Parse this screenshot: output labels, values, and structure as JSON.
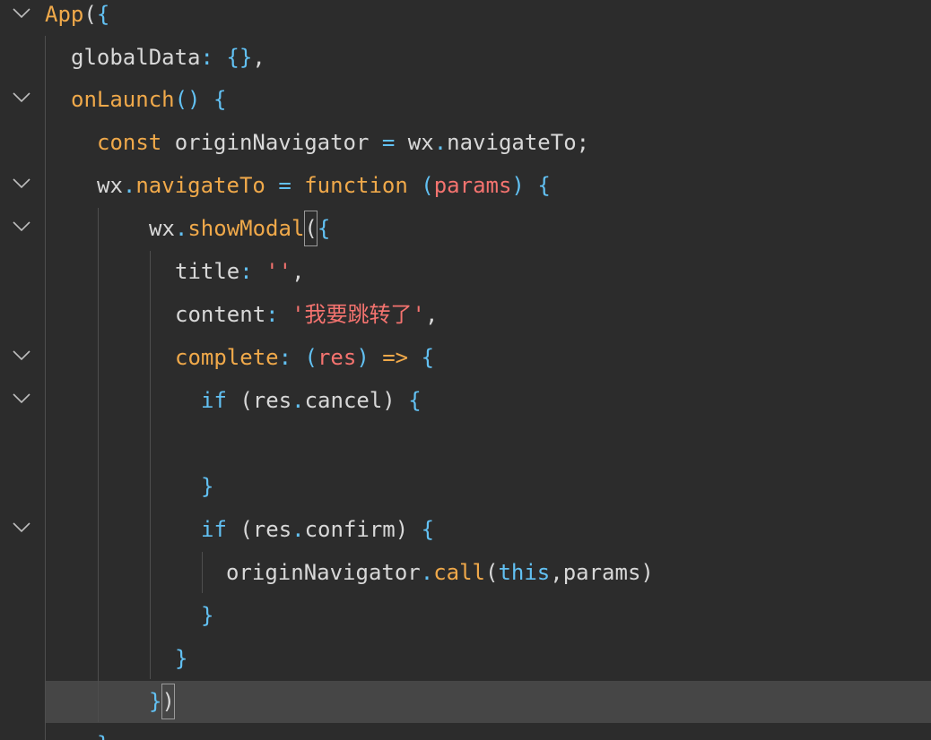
{
  "editor": {
    "lines": [
      {
        "id": "l1",
        "tokens": [
          [
            "App",
            "orange"
          ],
          [
            "(",
            "plain"
          ],
          [
            "{",
            "blue"
          ]
        ]
      },
      {
        "id": "l2",
        "tokens": [
          [
            "globalData",
            "plain"
          ],
          [
            ": ",
            "blue"
          ],
          [
            "{}",
            "blue"
          ],
          [
            ",",
            "plain"
          ]
        ]
      },
      {
        "id": "l3",
        "tokens": [
          [
            "onLaunch",
            "orange"
          ],
          [
            "()",
            "blue"
          ],
          [
            " ",
            "plain"
          ],
          [
            "{",
            "blue"
          ]
        ]
      },
      {
        "id": "l4",
        "tokens": [
          [
            "const",
            "orange"
          ],
          [
            " originNavigator ",
            "plain"
          ],
          [
            "=",
            "blue"
          ],
          [
            " wx",
            "plain"
          ],
          [
            ".",
            "blue"
          ],
          [
            "navigateTo",
            "plain"
          ],
          [
            ";",
            "plain"
          ]
        ]
      },
      {
        "id": "l5",
        "tokens": [
          [
            "wx",
            "plain"
          ],
          [
            ".",
            "blue"
          ],
          [
            "navigateTo",
            "orange"
          ],
          [
            " ",
            "plain"
          ],
          [
            "=",
            "blue"
          ],
          [
            " ",
            "plain"
          ],
          [
            "function",
            "orange"
          ],
          [
            " ",
            "plain"
          ],
          [
            "(",
            "blue"
          ],
          [
            "params",
            "red"
          ],
          [
            ")",
            "blue"
          ],
          [
            " ",
            "plain"
          ],
          [
            "{",
            "blue"
          ]
        ]
      },
      {
        "id": "l6",
        "tokens": [
          [
            "wx",
            "plain"
          ],
          [
            ".",
            "blue"
          ],
          [
            "showModal",
            "orange"
          ],
          [
            "(",
            "box"
          ],
          [
            "{",
            "blue"
          ]
        ]
      },
      {
        "id": "l7",
        "tokens": [
          [
            "title",
            "plain"
          ],
          [
            ": ",
            "blue"
          ],
          [
            "''",
            "red"
          ],
          [
            ",",
            "plain"
          ]
        ]
      },
      {
        "id": "l8",
        "tokens": [
          [
            "content",
            "plain"
          ],
          [
            ": ",
            "blue"
          ],
          [
            "'我要跳转了'",
            "red"
          ],
          [
            ",",
            "plain"
          ]
        ]
      },
      {
        "id": "l9",
        "tokens": [
          [
            "complete",
            "orange"
          ],
          [
            ": ",
            "blue"
          ],
          [
            "(",
            "blue"
          ],
          [
            "res",
            "red"
          ],
          [
            ")",
            "blue"
          ],
          [
            " ",
            "plain"
          ],
          [
            "=>",
            "orange"
          ],
          [
            " ",
            "plain"
          ],
          [
            "{",
            "blue"
          ]
        ]
      },
      {
        "id": "l10",
        "tokens": [
          [
            "if",
            "blue"
          ],
          [
            " (res",
            "plain"
          ],
          [
            ".",
            "blue"
          ],
          [
            "cancel) ",
            "plain"
          ],
          [
            "{",
            "blue"
          ]
        ]
      },
      {
        "id": "l11",
        "tokens": []
      },
      {
        "id": "l12",
        "tokens": [
          [
            "}",
            "blue"
          ]
        ]
      },
      {
        "id": "l13",
        "tokens": [
          [
            "if",
            "blue"
          ],
          [
            " (res",
            "plain"
          ],
          [
            ".",
            "blue"
          ],
          [
            "confirm) ",
            "plain"
          ],
          [
            "{",
            "blue"
          ]
        ]
      },
      {
        "id": "l14",
        "tokens": [
          [
            "originNavigator",
            "plain"
          ],
          [
            ".",
            "blue"
          ],
          [
            "call",
            "orange"
          ],
          [
            "(",
            "plain"
          ],
          [
            "this",
            "blue"
          ],
          [
            ",params)",
            "plain"
          ]
        ]
      },
      {
        "id": "l15",
        "tokens": [
          [
            "}",
            "blue"
          ]
        ]
      },
      {
        "id": "l16",
        "tokens": [
          [
            "}",
            "blue"
          ]
        ]
      },
      {
        "id": "l17",
        "tokens": [
          [
            "}",
            "blue"
          ],
          [
            ")",
            "box"
          ]
        ]
      },
      {
        "id": "l18",
        "tokens": [
          [
            "}",
            "blue"
          ]
        ]
      }
    ]
  },
  "colors": {
    "background": "#2c2c2c",
    "current_line": "#464646",
    "orange": "#f0a94a",
    "blue": "#62c1f3",
    "red": "#f4736f",
    "plain": "#d8d8d8"
  },
  "fold_icon": "chevron-down-icon"
}
